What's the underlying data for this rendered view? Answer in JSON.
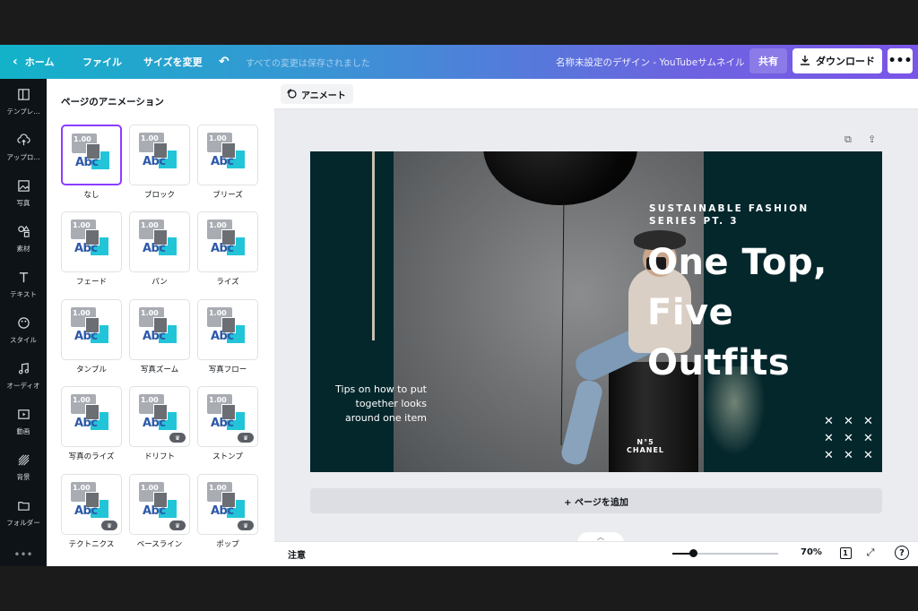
{
  "topbar": {
    "home": "ホーム",
    "file": "ファイル",
    "resize": "サイズを変更",
    "saved_status": "すべての変更は保存されました",
    "design_title": "名称未設定のデザイン - YouTubeサムネイル",
    "share": "共有",
    "download": "ダウンロード",
    "more": "•••"
  },
  "rail": {
    "items": [
      {
        "label": "テンプレ...",
        "icon": "template-icon"
      },
      {
        "label": "アップロ...",
        "icon": "upload-icon"
      },
      {
        "label": "写真",
        "icon": "photo-icon"
      },
      {
        "label": "素材",
        "icon": "elements-icon"
      },
      {
        "label": "テキスト",
        "icon": "text-icon"
      },
      {
        "label": "スタイル",
        "icon": "style-icon"
      },
      {
        "label": "オーディオ",
        "icon": "audio-icon"
      },
      {
        "label": "動画",
        "icon": "video-icon"
      },
      {
        "label": "背景",
        "icon": "background-icon"
      },
      {
        "label": "フォルダー",
        "icon": "folder-icon"
      }
    ],
    "more": "•••"
  },
  "panel": {
    "title": "ページのアニメーション",
    "thumb_text": "1.00",
    "thumb_abc": "Abc",
    "crown": "♛",
    "animations": [
      {
        "label": "なし",
        "pro": false,
        "selected": true
      },
      {
        "label": "ブロック",
        "pro": false
      },
      {
        "label": "ブリーズ",
        "pro": false
      },
      {
        "label": "フェード",
        "pro": false
      },
      {
        "label": "パン",
        "pro": false
      },
      {
        "label": "ライズ",
        "pro": false
      },
      {
        "label": "タンブル",
        "pro": false
      },
      {
        "label": "写真ズーム",
        "pro": false
      },
      {
        "label": "写真フロー",
        "pro": false
      },
      {
        "label": "写真のライズ",
        "pro": false
      },
      {
        "label": "ドリフト",
        "pro": true
      },
      {
        "label": "ストンプ",
        "pro": true
      },
      {
        "label": "テクトニクス",
        "pro": true
      },
      {
        "label": "ベースライン",
        "pro": true
      },
      {
        "label": "ポップ",
        "pro": true
      }
    ]
  },
  "toolbar": {
    "animate": "アニメート"
  },
  "canvas": {
    "subtitle": "SUSTAINABLE FASHION\nSERIES PT. 3",
    "title": "One Top,\nFive\nOutfits",
    "tips": "Tips on how to put together looks around one item",
    "barrel_label": "N°5\nCHANEL",
    "x_marks": [
      "✕",
      "✕",
      "✕",
      "✕",
      "✕",
      "✕",
      "✕",
      "✕",
      "✕"
    ],
    "colors": {
      "background": "#04272c",
      "accent_bar": "#c9bfb0"
    }
  },
  "add_page": "+ ページを追加",
  "footer": {
    "notes": "注意",
    "zoom": "70%",
    "zoom_level": 0.2,
    "page_count": "1",
    "help": "?"
  },
  "colors": {
    "topbar_start": "#12b3c9",
    "topbar_end": "#7a55e8",
    "selected_border": "#8b3dff",
    "rail_bg": "#0e1318"
  }
}
